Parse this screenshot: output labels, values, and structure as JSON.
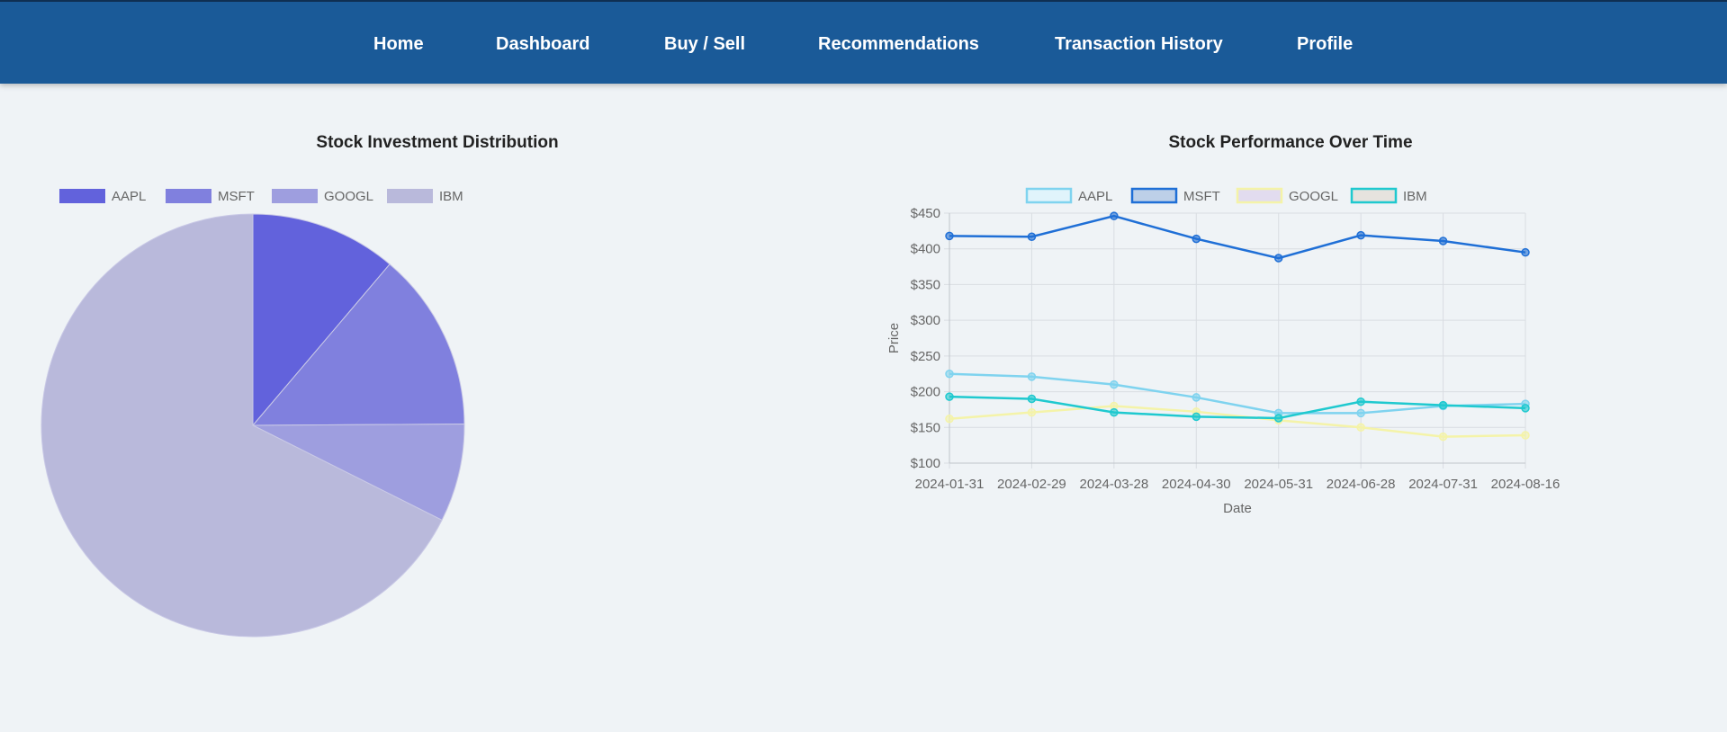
{
  "nav": {
    "items": [
      {
        "label": "Home"
      },
      {
        "label": "Dashboard"
      },
      {
        "label": "Buy / Sell"
      },
      {
        "label": "Recommendations"
      },
      {
        "label": "Transaction History"
      },
      {
        "label": "Profile"
      }
    ]
  },
  "chart_data": [
    {
      "type": "pie",
      "title": "Stock Investment Distribution",
      "legend_position": "top",
      "categories": [
        "AAPL",
        "MSFT",
        "GOOGL",
        "IBM"
      ],
      "values": [
        11.2,
        13.7,
        7.5,
        67.6
      ],
      "colors": [
        "#6262dc",
        "#8080de",
        "#9e9edf",
        "#b9b9db"
      ]
    },
    {
      "type": "line",
      "title": "Stock Performance Over Time",
      "xlabel": "Date",
      "ylabel": "Price",
      "legend_position": "top",
      "grid": true,
      "ylim": [
        100,
        450
      ],
      "yticks": [
        "$100",
        "$150",
        "$200",
        "$250",
        "$300",
        "$350",
        "$400",
        "$450"
      ],
      "categories": [
        "2024-01-31",
        "2024-02-29",
        "2024-03-28",
        "2024-04-30",
        "2024-05-31",
        "2024-06-28",
        "2024-07-31",
        "2024-08-16"
      ],
      "series": [
        {
          "name": "AAPL",
          "color": "#7fd3ef",
          "fill": "#e0f4fb",
          "values": [
            225,
            221,
            210,
            192,
            170,
            170,
            180,
            183
          ]
        },
        {
          "name": "MSFT",
          "color": "#1f6fd6",
          "fill": "#bdd0e8",
          "values": [
            418,
            417,
            446,
            414,
            387,
            419,
            411,
            395
          ]
        },
        {
          "name": "GOOGL",
          "color": "#f4f3a8",
          "fill": "#e2dcef",
          "values": [
            162,
            171,
            180,
            172,
            160,
            150,
            137,
            139
          ]
        },
        {
          "name": "IBM",
          "color": "#1fc9cf",
          "fill": "#e6e3de",
          "values": [
            193,
            190,
            171,
            165,
            163,
            186,
            181,
            177
          ]
        }
      ]
    }
  ]
}
